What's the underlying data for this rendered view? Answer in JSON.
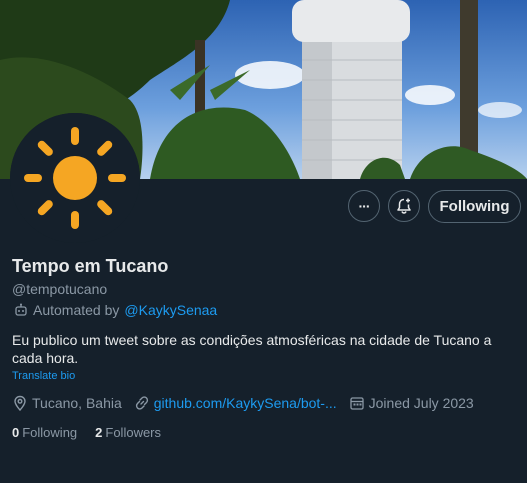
{
  "profile": {
    "name": "Tempo em Tucano",
    "handle": "@tempotucano",
    "automated_prefix": "Automated by",
    "automated_by": "@KaykySenaa",
    "bio": "Eu publico um tweet sobre as condições atmosféricas na cidade de Tucano a cada hora.",
    "translate_bio": "Translate bio",
    "location": "Tucano, Bahia",
    "website": "github.com/KaykySena/bot-...",
    "joined": "Joined July 2023",
    "following_count": "0",
    "following_label": "Following",
    "followers_count": "2",
    "followers_label": "Followers"
  },
  "actions": {
    "more_label": "···",
    "follow_button": "Following"
  },
  "icons": {
    "avatar": "sun-icon",
    "more": "more-icon",
    "notify": "bell-plus-icon",
    "automated": "robot-icon",
    "location": "location-pin-icon",
    "website": "link-icon",
    "joined": "calendar-icon"
  },
  "colors": {
    "background": "#15202b",
    "accent": "#1d9bf0",
    "muted_text": "#8b98a5",
    "sun": "#f5a623"
  }
}
